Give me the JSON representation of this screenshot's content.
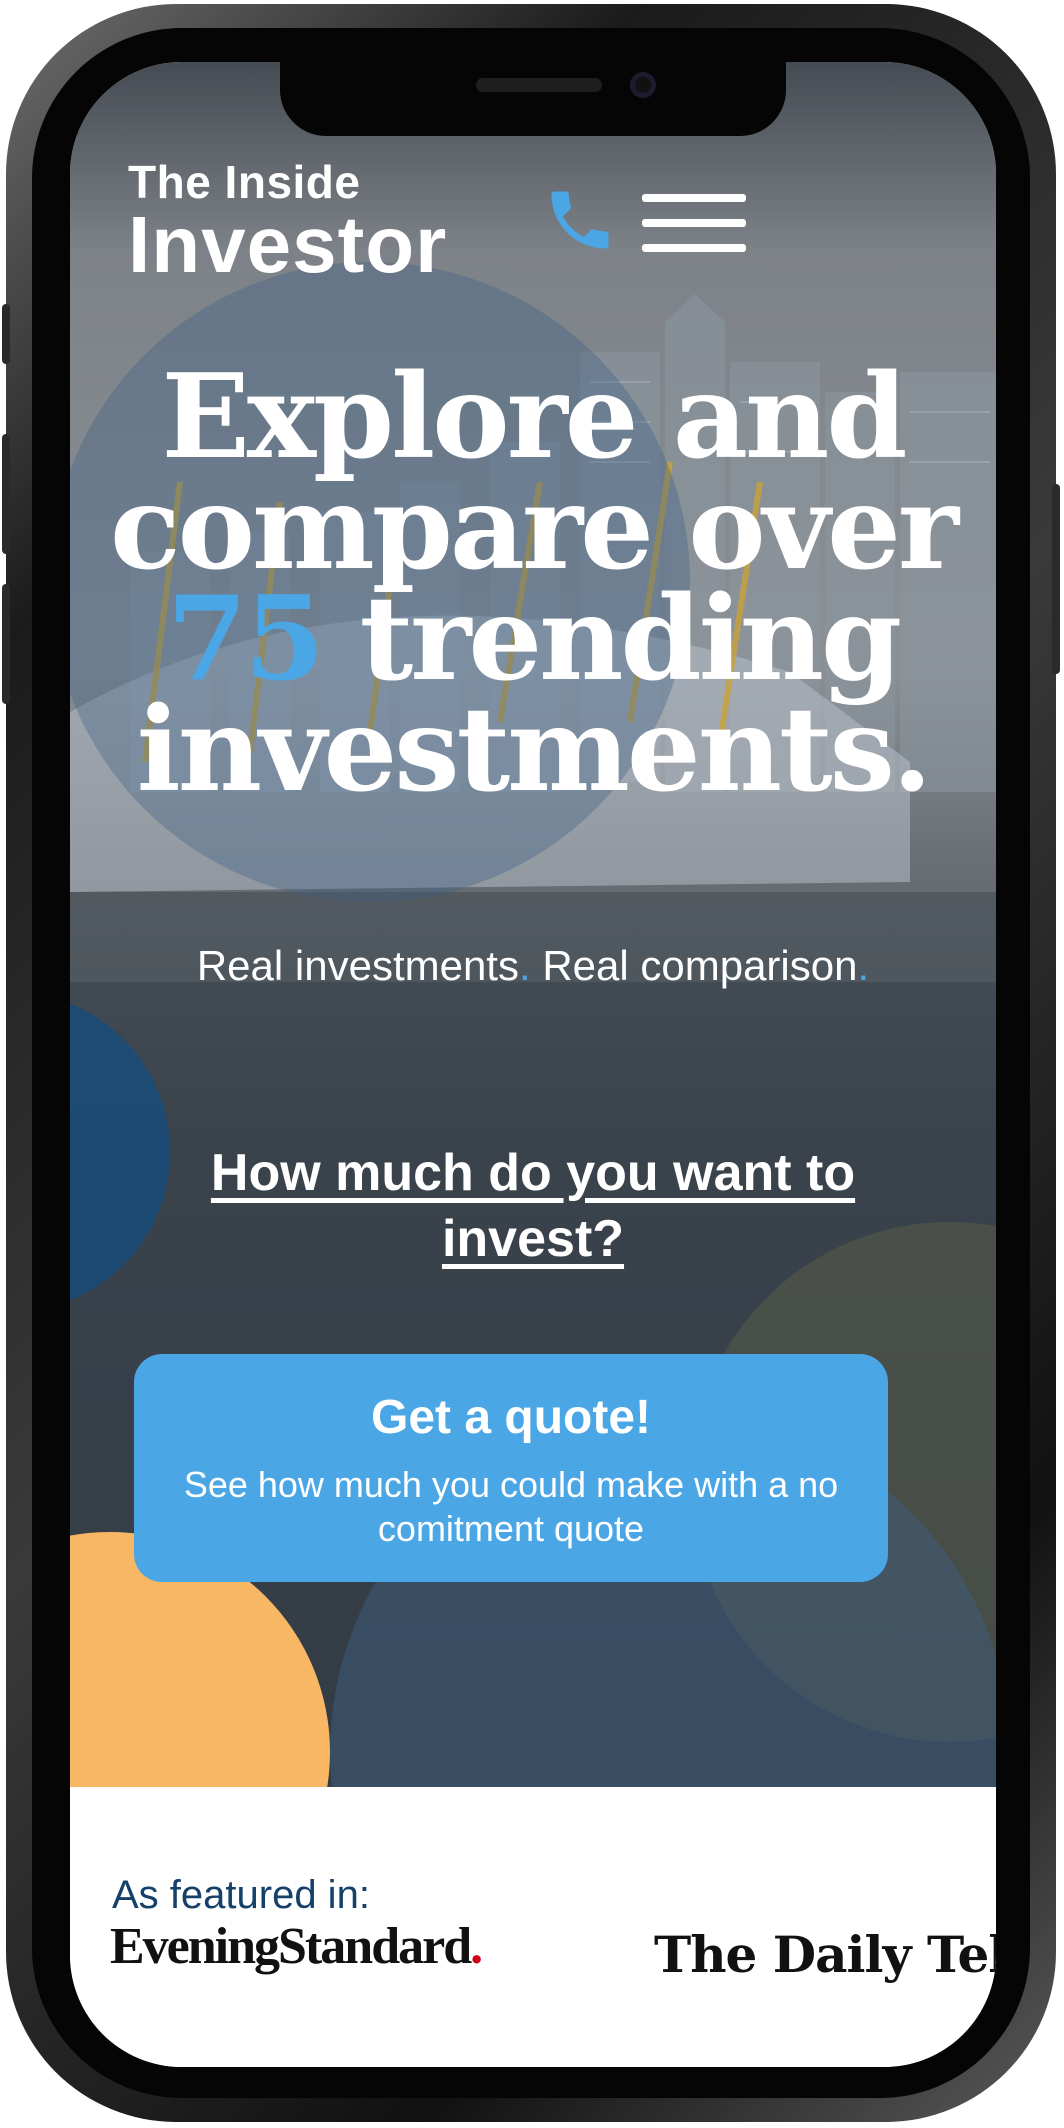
{
  "header": {
    "logo_line1": "The Inside",
    "logo_line2": "Investor"
  },
  "hero": {
    "headline_line1": "Explore and",
    "headline_line2": "compare over",
    "headline_number": "75",
    "headline_line3_rest": "trending",
    "headline_line4": "investments.",
    "sub_part1": "Real investments",
    "sub_dot": ".",
    "sub_part2": " Real comparison",
    "question": "How much do you want to invest?"
  },
  "cta": {
    "title": "Get a quote!",
    "subtitle": "See how much you could make with a no comitment quote"
  },
  "featured": {
    "label": "As featured in:",
    "logos": [
      "EveningStandard",
      "The Daily Telegr"
    ]
  },
  "colors": {
    "accent": "#4aa6e4",
    "navy": "#15406a",
    "orange": "#f7b764",
    "evening_standard_red": "#d0021b"
  },
  "icons": {
    "phone": "phone-icon",
    "menu": "hamburger-menu-icon"
  }
}
